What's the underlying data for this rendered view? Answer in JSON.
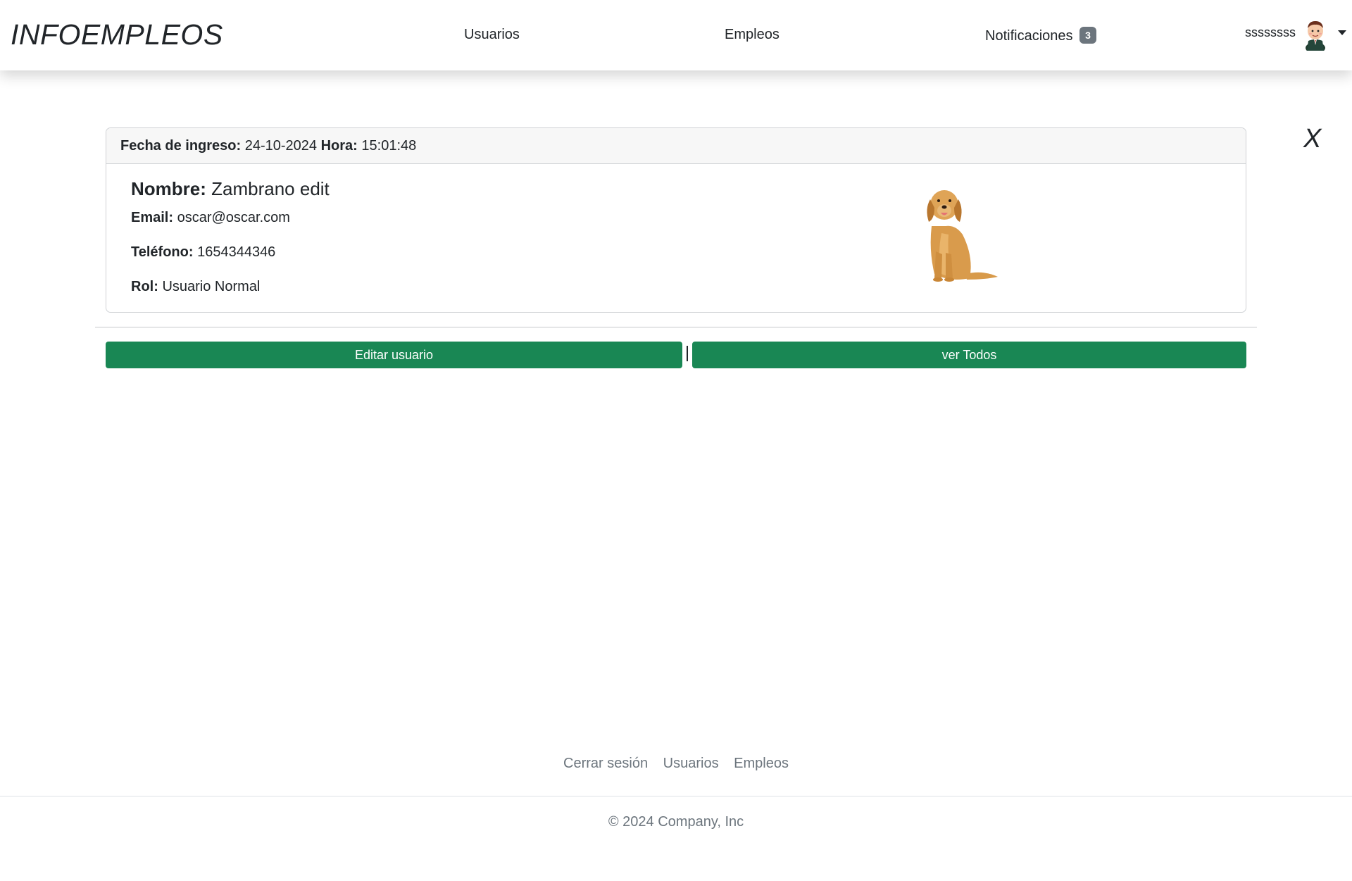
{
  "navbar": {
    "brand": "INFOEMPLEOS",
    "links": {
      "users": "Usuarios",
      "jobs": "Empleos",
      "notifications": "Notificaciones"
    },
    "notification_count": "3",
    "badge_color": "#6c757d",
    "user": {
      "name": "ssssssss",
      "avatar_icon": "user-avatar-icon"
    }
  },
  "close_label": "X",
  "card": {
    "header": {
      "date_label": "Fecha de ingreso:",
      "date_value": "24-10-2024",
      "time_label": "Hora:",
      "time_value": "15:01:48"
    },
    "name_label": "Nombre:",
    "name_value": "Zambrano edit",
    "email_label": "Email:",
    "email_value": "oscar@oscar.com",
    "phone_label": "Teléfono:",
    "phone_value": "1654344346",
    "role_label": "Rol:",
    "role_value": "Usuario Normal",
    "photo_icon": "dog-photo"
  },
  "actions": {
    "edit_label": "Editar usuario",
    "separator": "|",
    "view_all_label": "ver Todos",
    "button_color": "#198754"
  },
  "footer": {
    "links": {
      "logout": "Cerrar sesión",
      "users": "Usuarios",
      "jobs": "Empleos"
    },
    "copyright": "© 2024 Company, Inc"
  }
}
